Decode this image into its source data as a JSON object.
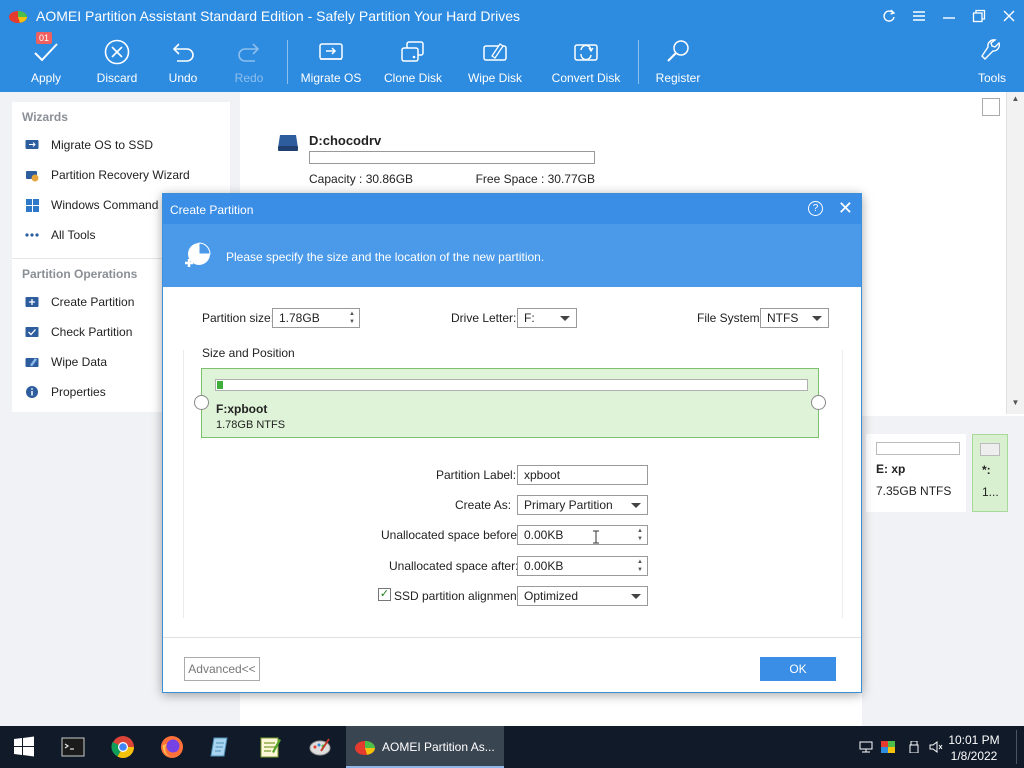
{
  "app": {
    "title": "AOMEI Partition Assistant Standard Edition - Safely Partition Your Hard Drives",
    "pending_count": "01"
  },
  "toolbar": {
    "apply": "Apply",
    "discard": "Discard",
    "undo": "Undo",
    "redo": "Redo",
    "migrate_os": "Migrate OS",
    "clone_disk": "Clone Disk",
    "wipe_disk": "Wipe Disk",
    "convert_disk": "Convert Disk",
    "register": "Register",
    "tools": "Tools"
  },
  "sidebar": {
    "wizards_title": "Wizards",
    "wizards": [
      "Migrate OS to SSD",
      "Partition Recovery Wizard",
      "Windows Command Line",
      "All Tools"
    ],
    "ops_title": "Partition Operations",
    "ops": [
      "Create Partition",
      "Check Partition",
      "Wipe Data",
      "Properties"
    ]
  },
  "disk": {
    "name": "D:chocodrv",
    "capacity": "Capacity : 30.86GB",
    "free": "Free Space : 30.77GB"
  },
  "partitions": {
    "e_name": "E: xp",
    "e_info": "7.35GB NTFS",
    "star_name": "*:",
    "star_info": "1..."
  },
  "dialog": {
    "title": "Create Partition",
    "banner": "Please specify the size and the location of the new partition.",
    "size_label": "Partition size:",
    "size_value": "1.78GB",
    "letter_label": "Drive Letter:",
    "letter_value": "F:",
    "fs_label": "File System:",
    "fs_value": "NTFS",
    "group_label": "Size and Position",
    "partition_name": "F:xpboot",
    "partition_info": "1.78GB NTFS",
    "partition_fill_fraction": 0.01,
    "label_label": "Partition Label:",
    "label_value": "xpboot",
    "create_as_label": "Create As:",
    "create_as_value": "Primary Partition",
    "before_label": "Unallocated space before:",
    "before_value": "0.00KB",
    "after_label": "Unallocated space after:",
    "after_value": "0.00KB",
    "ssd_label": "SSD partition alignment:",
    "ssd_checked": true,
    "ssd_value": "Optimized",
    "advanced": "Advanced<<",
    "ok": "OK"
  },
  "taskbar": {
    "active_app": "AOMEI Partition As...",
    "time": "10:01 PM",
    "date": "1/8/2022"
  },
  "colors": {
    "header_blue": "#2d8be0",
    "dialog_blue": "#3a8ee6",
    "partition_green": "#dff3d8",
    "taskbar": "#101a28"
  }
}
